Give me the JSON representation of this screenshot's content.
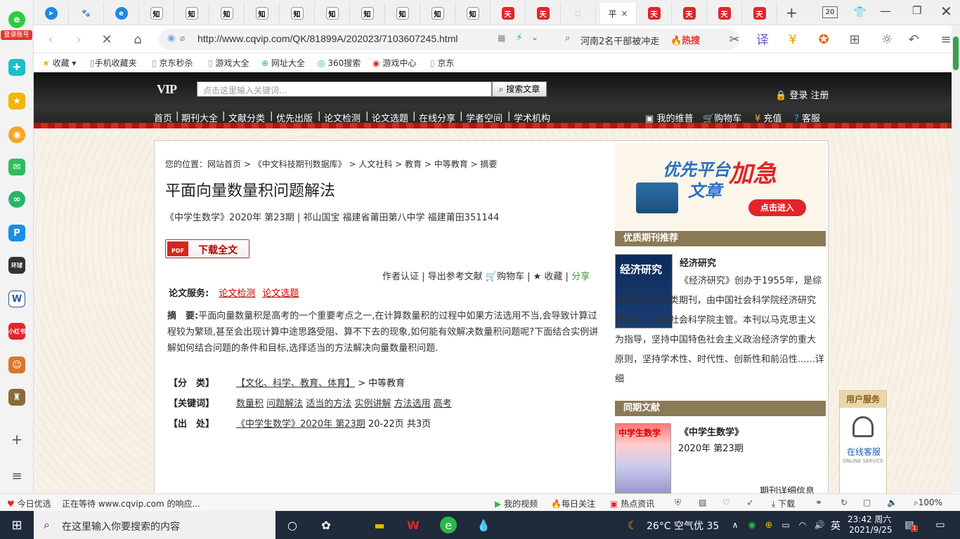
{
  "sidebar": {
    "login_label": "登录账号",
    "icons": [
      "cloud-icon",
      "star-icon",
      "weibo-icon",
      "mail-icon",
      "link-icon",
      "p-icon",
      "game-icon",
      "word-icon",
      "xiaohongshu-icon",
      "game2-icon",
      "game3-icon"
    ],
    "add": "+",
    "list": "≡"
  },
  "tabs": {
    "active_label": "平",
    "close": "×",
    "count": "20"
  },
  "address": {
    "url": "http://www.cqvip.com/QK/81899A/202023/7103607245.html",
    "search_query": "河南2名干部被冲走",
    "hot_label": "🔥热搜"
  },
  "bookmarks": [
    "收藏",
    "手机收藏夹",
    "京东秒杀",
    "游戏大全",
    "网址大全",
    "360搜索",
    "游戏中心",
    "京东"
  ],
  "site": {
    "logo": "VIP",
    "search_placeholder": "点击这里输入关键词...",
    "search_button": "搜索文章",
    "login": "登录 注册",
    "menu": [
      "首页",
      "期刊大全",
      "文献分类",
      "优先出版",
      "论文检测",
      "论文选题",
      "在线分享",
      "学者空间",
      "学术机构"
    ],
    "menu_right": [
      "我的维普",
      "购物车",
      "充值",
      "客服"
    ]
  },
  "article": {
    "breadcrumb": "您的位置：网站首页 > 《中文科技期刊数据库》 > 人文社科 > 教育 > 中等教育 > 摘要",
    "title": "平面向量数量积问题解法",
    "meta": "《中学生数学》2020年 第23期 | 祁山国宝    福建省莆田第八中学 福建莆田351144",
    "download": "下载全文",
    "pdf": "PDF",
    "actions": "作者认证 | 导出参考文献 🛒购物车 | ★ 收藏 |",
    "share": "分享",
    "service_label": "论文服务:",
    "service_links": [
      "论文检测",
      "论文选题"
    ],
    "abstract_label": "摘　要:",
    "abstract": "平面向量数量积是高考的一个重要考点之一,在计算数量积的过程中如果方法选用不当,会导致计算过程较为繁琐,甚至会出现计算中途思路受阻、算不下去的现象,如何能有效解决数量积问题呢?下面结合实例讲解如何结合问题的条件和目标,选择适当的方法解决向量数量积问题.",
    "class_label": "【分　类】",
    "class_value": "【文化、科学、教育、体育】",
    "class_sub": "> 中等教育",
    "kw_label": "【关键词】",
    "keywords": [
      "数量积",
      "问题解法",
      "适当的方法",
      "实例讲解",
      "方法选用",
      "高考"
    ],
    "src_label": "【出　处】",
    "src_link": "《中学生数学》2020年 第23期",
    "src_pages": "20-22页 共3页"
  },
  "right": {
    "banner_t1": "优先平台",
    "banner_t1b": "文章",
    "banner_t2": "加急",
    "banner_btn": "点击进入",
    "recommend_head": "优质期刊推荐",
    "journal_cover": "经济研究",
    "journal_name": "经济研究",
    "journal_desc": "《经济研究》创办于1955年，是综合性经济理论类期刊，由中国社会科学院经济研究所主办，中国社会科学院主管。本刊以马克思主义为指导，坚持中国特色社会主义政治经济学的重大原则，坚持学术性、时代性、创新性和前沿性......详细",
    "same_head": "同期文献",
    "same_cover": "中学生数学",
    "same_name": "《中学生数学》",
    "same_issue": "2020年 第23期",
    "more_info": "期刊详细信息"
  },
  "user_service": {
    "head": "用户服务",
    "label": "在线客服",
    "en": "ONLINE SERVICE"
  },
  "statusbar": {
    "left1": "今日优选",
    "left2": "正在等待 www.cqvip.com 的响应...",
    "items": [
      "我的视频",
      "每日关注",
      "热点资讯"
    ],
    "download": "下载",
    "zoom": "100%"
  },
  "taskbar": {
    "search_placeholder": "在这里输入你要搜索的内容",
    "weather": "26°C 空气优 35",
    "ime": "英",
    "time": "23:42 周六",
    "date": "2021/9/25",
    "notif": "1"
  }
}
